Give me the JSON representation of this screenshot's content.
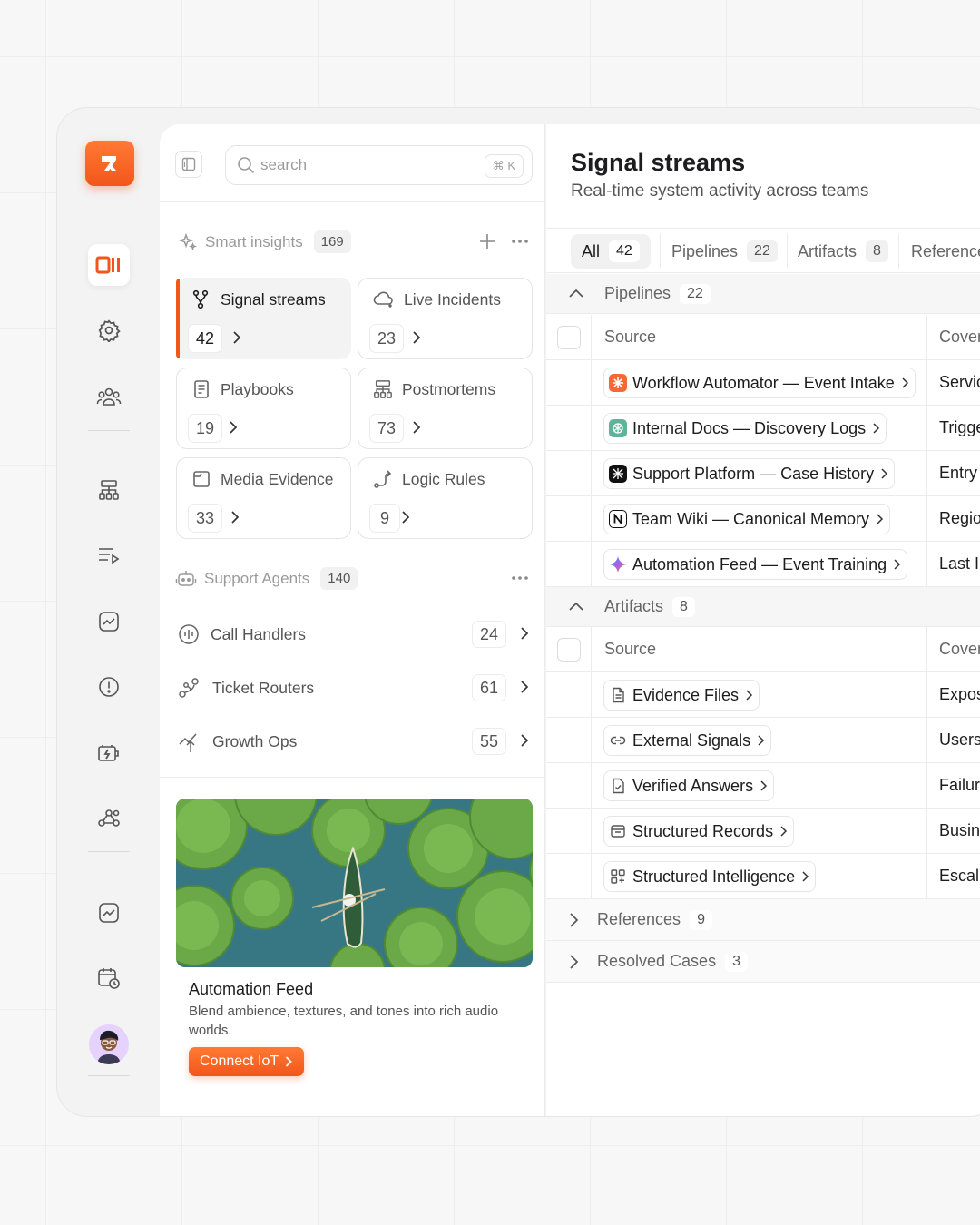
{
  "search": {
    "placeholder": "search",
    "shortcut": "⌘ K"
  },
  "smart_insights": {
    "label": "Smart insights",
    "count": "169"
  },
  "cards": [
    {
      "label": "Signal streams",
      "count": "42",
      "icon": "branch-icon"
    },
    {
      "label": "Live Incidents",
      "count": "23",
      "icon": "cloud-icon"
    },
    {
      "label": "Playbooks",
      "count": "19",
      "icon": "document-icon"
    },
    {
      "label": "Postmortems",
      "count": "73",
      "icon": "hierarchy-icon"
    },
    {
      "label": "Media Evidence",
      "count": "33",
      "icon": "folder-icon"
    },
    {
      "label": "Logic Rules",
      "count": "9",
      "icon": "route-icon"
    }
  ],
  "support_agents": {
    "label": "Support Agents",
    "count": "140"
  },
  "agents": [
    {
      "label": "Call Handlers",
      "count": "24"
    },
    {
      "label": "Ticket Routers",
      "count": "61"
    },
    {
      "label": "Growth Ops",
      "count": "55"
    }
  ],
  "promo": {
    "title": "Automation Feed",
    "description": "Blend ambience, textures, and tones into rich audio worlds.",
    "button": "Connect IoT"
  },
  "main": {
    "title": "Signal streams",
    "subtitle": "Real-time system activity across teams",
    "tabs": [
      {
        "label": "All",
        "count": "42"
      },
      {
        "label": "Pipelines",
        "count": "22"
      },
      {
        "label": "Artifacts",
        "count": "8"
      },
      {
        "label": "Reference"
      }
    ],
    "groups": {
      "pipelines": {
        "label": "Pipelines",
        "count": "22",
        "col_source": "Source",
        "col_cover": "Cover",
        "rows": [
          {
            "source": "Workflow Automator — Event Intake",
            "cover": "Servic"
          },
          {
            "source": "Internal Docs — Discovery Logs",
            "cover": "Trigge"
          },
          {
            "source": "Support Platform — Case History",
            "cover": "Entry"
          },
          {
            "source": "Team Wiki — Canonical Memory",
            "cover": "Regio"
          },
          {
            "source": "Automation Feed — Event Training",
            "cover": "Last I"
          }
        ]
      },
      "artifacts": {
        "label": "Artifacts",
        "count": "8",
        "col_source": "Source",
        "col_cover": "Cover",
        "rows": [
          {
            "source": "Evidence Files",
            "cover": "Expos"
          },
          {
            "source": "External Signals",
            "cover": "Users"
          },
          {
            "source": "Verified Answers",
            "cover": "Failur"
          },
          {
            "source": "Structured Records",
            "cover": "Busin"
          },
          {
            "source": "Structured Intelligence",
            "cover": "Escal"
          }
        ]
      },
      "references": {
        "label": "References",
        "count": "9"
      },
      "resolved": {
        "label": "Resolved Cases",
        "count": "3"
      }
    }
  },
  "colors": {
    "accent": "#f2561b",
    "accent_light": "#ff7a33"
  }
}
